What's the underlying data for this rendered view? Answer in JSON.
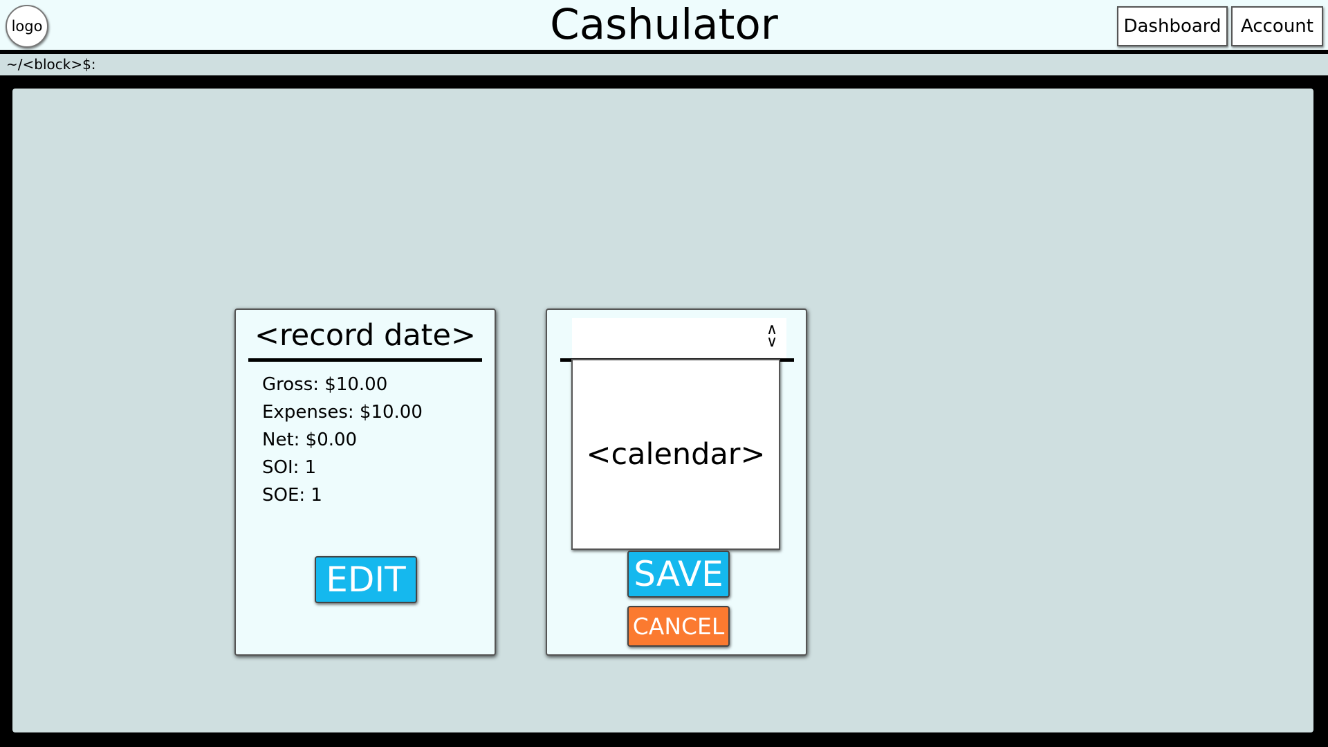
{
  "header": {
    "logo_text": "logo",
    "app_title": "Cashulator",
    "nav": {
      "dashboard": "Dashboard",
      "account": "Account"
    }
  },
  "pathbar": {
    "path": "~/<block>$:"
  },
  "record_card": {
    "title": "<record date>",
    "stats": [
      "Gross: $10.00",
      "Expenses: $10.00",
      "Net: $0.00",
      "SOI: 1",
      "SOE: 1"
    ],
    "edit_label": "EDIT"
  },
  "edit_card": {
    "date_select_value": "",
    "sort_icon": "sort-up-down-icon",
    "calendar_placeholder": "<calendar>",
    "save_label": "SAVE",
    "cancel_label": "CANCEL"
  },
  "colors": {
    "header_bg": "#eefcfd",
    "content_bg": "#cfdfe0",
    "primary_button": "#15b8ee",
    "cancel_button": "#fb7a30"
  }
}
